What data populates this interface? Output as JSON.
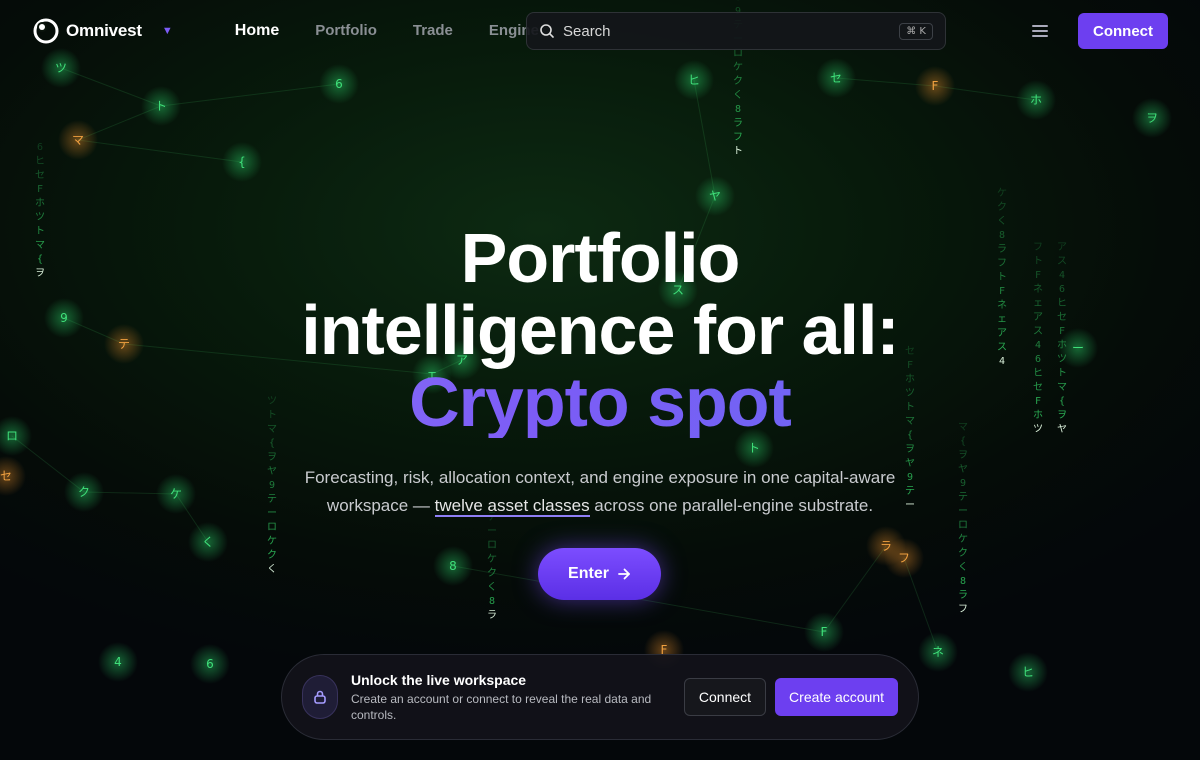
{
  "brand": {
    "name": "Omnivest"
  },
  "nav": {
    "items": [
      "Home",
      "Portfolio",
      "Trade",
      "Engine"
    ],
    "active": "Home"
  },
  "search": {
    "placeholder": "Search",
    "shortcut": "⌘ K"
  },
  "header": {
    "connect_label": "Connect"
  },
  "hero": {
    "line1": "Portfolio",
    "line2": "intelligence for all:",
    "accent": "Crypto spot",
    "sub_before": "Forecasting, risk, allocation context, and engine exposure in one capital-aware workspace — ",
    "sub_underline": "twelve asset classes",
    "sub_after": " across one parallel-engine substrate.",
    "enter_label": "Enter"
  },
  "unlock": {
    "title": "Unlock the live workspace",
    "description": "Create an account or connect to reveal the real data and controls.",
    "connect_label": "Connect",
    "create_label": "Create account"
  },
  "colors": {
    "accent": "#6d3ff0",
    "glow_green": "#2bd36a",
    "glow_orange": "#e08a2a"
  },
  "background": {
    "node_glyphs": [
      "6",
      "ヒ",
      "セ",
      "F",
      "ホ",
      "ツ",
      "ト",
      "マ",
      "{",
      "ヲ",
      "ヤ",
      "9",
      "テ",
      "ー",
      "ロ",
      "ケ",
      "ク",
      "く",
      "8",
      "ラ",
      "フ",
      "ト",
      "F",
      "ネ",
      "ェ",
      "ア",
      "ス",
      "4"
    ]
  }
}
